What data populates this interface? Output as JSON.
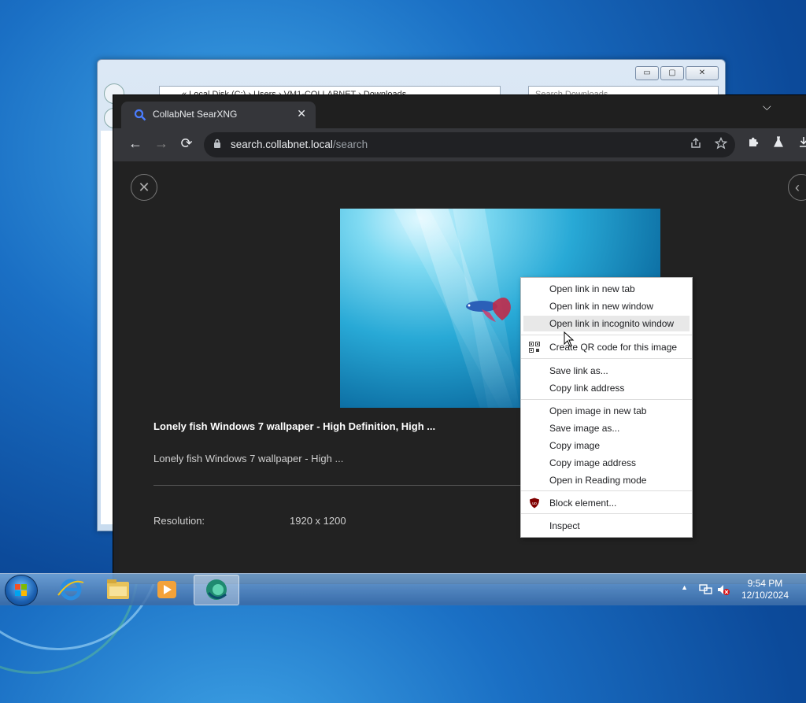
{
  "explorer": {
    "address": "« Local Disk (C:) › Users › VM1-COLLABNET › Downloads",
    "search_placeholder": "Search Downloads",
    "minimize": "▭",
    "maximize": "▢",
    "close": "✕"
  },
  "browser": {
    "tab_title": "CollabNet SearXNG",
    "tab_close": "✕",
    "url_host": "search.collabnet.local",
    "url_path": "/search",
    "back": "←",
    "forward": "→",
    "reload": "⟳",
    "tab_menu": "⌵"
  },
  "result": {
    "title": "Lonely fish Windows 7 wallpaper - High Definition, High ...",
    "description": "Lonely fish Windows 7 wallpaper - High ...",
    "resolution_label": "Resolution:",
    "resolution_value": "1920 x 1200",
    "close": "✕",
    "next": "‹"
  },
  "context_menu": {
    "items": [
      "Open link in new tab",
      "Open link in new window",
      "Open link in incognito window",
      "Create QR code for this image",
      "Save link as...",
      "Copy link address",
      "Open image in new tab",
      "Save image as...",
      "Copy image",
      "Copy image address",
      "Open in Reading mode",
      "Block element...",
      "Inspect"
    ],
    "highlighted": "Open link in incognito window"
  },
  "taskbar": {
    "time": "9:54 PM",
    "date": "12/10/2024",
    "tray_expand": "▲"
  },
  "colors": {
    "browser_bg": "#202124",
    "menu_bg": "#ffffff",
    "accent": "#8ab4f8",
    "ublock_red": "#800000"
  }
}
